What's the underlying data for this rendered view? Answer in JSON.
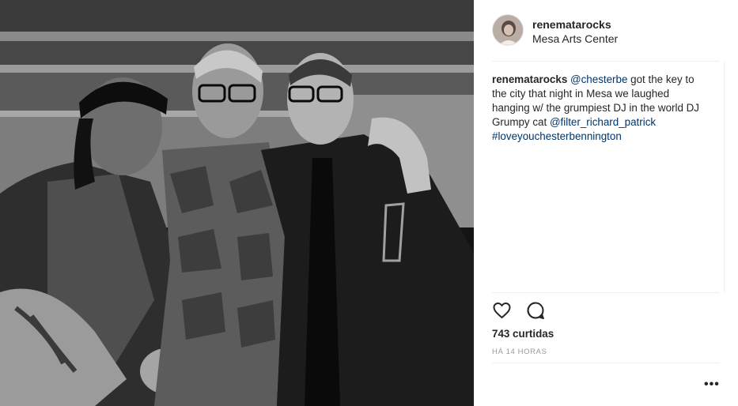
{
  "post": {
    "username": "renematarocks",
    "location": "Mesa Arts Center",
    "caption": {
      "user": "renematarocks",
      "text_parts": [
        {
          "text": " ",
          "type": "plain"
        },
        {
          "text": "@chesterbe",
          "type": "mention"
        },
        {
          "text": " got the key to the city that night in Mesa we laughed hanging w/ the grumpiest DJ in the world DJ Grumpy cat ",
          "type": "plain"
        },
        {
          "text": "@filter_richard_patrick",
          "type": "mention"
        },
        {
          "text": " ",
          "type": "plain"
        },
        {
          "text": "#loveyouchesterbennington",
          "type": "hashtag"
        }
      ]
    },
    "likes": "743 curtidas",
    "timestamp": "HÁ 14 HORAS",
    "more_label": "•••",
    "icons": {
      "like": "heart-icon",
      "comment": "comment-icon",
      "more": "more-options-icon"
    }
  },
  "colors": {
    "text": "#262626",
    "link": "#003569",
    "muted": "#999999",
    "divider": "#efefef"
  }
}
